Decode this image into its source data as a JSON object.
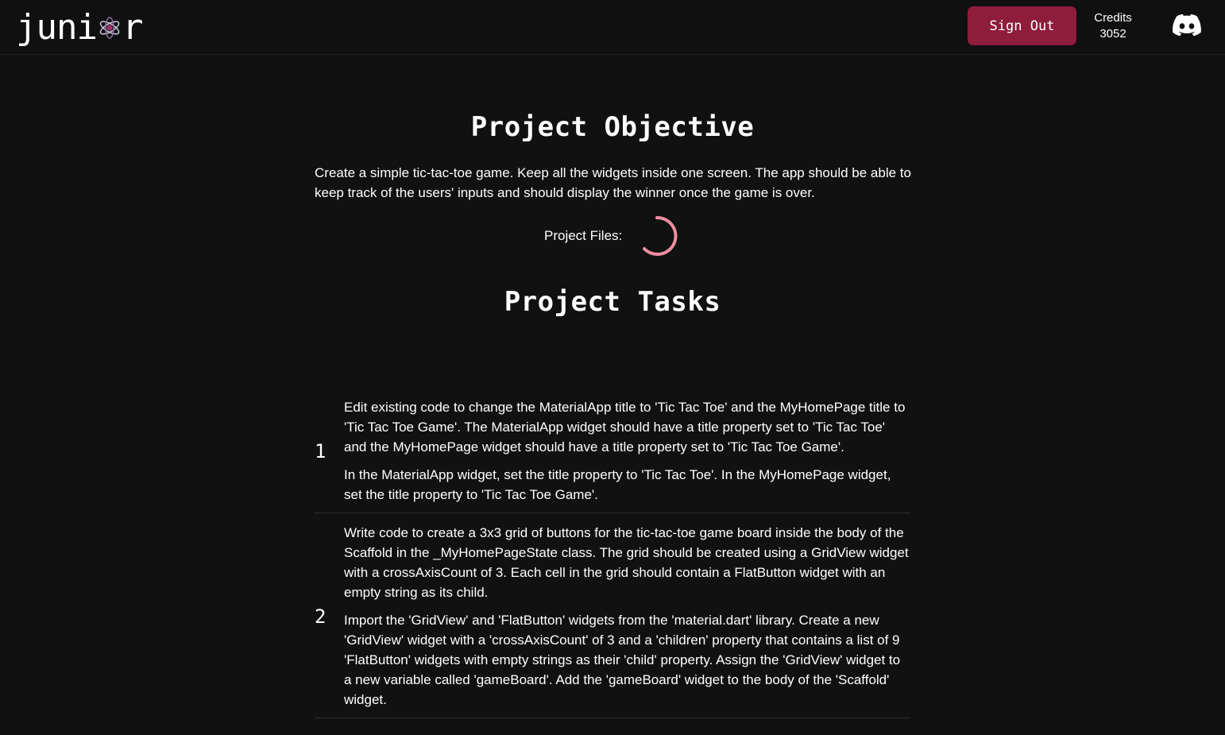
{
  "header": {
    "logo_text_left": "juni",
    "logo_text_right": "r",
    "sign_out_label": "Sign Out",
    "credits_label": "Credits",
    "credits_value": "3052",
    "discord_icon": "discord-icon"
  },
  "objective": {
    "title": "Project Objective",
    "description": "Create a simple tic-tac-toe game. Keep all the widgets inside one screen. The app should be able to keep  track of the users' inputs and should display the winner once the game is over.",
    "files_label": "Project Files:",
    "loading_indicator": "loading-spinner-icon"
  },
  "tasks": {
    "title": "Project Tasks",
    "items": [
      {
        "number": "1",
        "description": "Edit existing code to change the MaterialApp title to 'Tic Tac Toe' and the MyHomePage title to 'Tic Tac Toe Game'. The MaterialApp widget should have a title property set to 'Tic Tac Toe' and the MyHomePage widget should have a title property set to 'Tic Tac Toe Game'.",
        "hint": "In the MaterialApp widget, set the title property to 'Tic Tac Toe'. In the MyHomePage widget, set the title property to 'Tic Tac Toe Game'."
      },
      {
        "number": "2",
        "description": "Write code to create a 3x3 grid of buttons for the tic-tac-toe game board inside the body of the Scaffold in the _MyHomePageState class. The grid should be created using a GridView widget with a crossAxisCount of 3. Each cell in the grid should contain a FlatButton widget with an empty string as its child.",
        "hint": "Import the 'GridView' and 'FlatButton' widgets from the 'material.dart' library. Create a new 'GridView' widget with a 'crossAxisCount' of 3 and a 'children' property that contains a list of 9 'FlatButton' widgets with empty strings as their 'child' property. Assign the 'GridView' widget to a new variable called 'gameBoard'. Add the 'gameBoard' widget to the body of the 'Scaffold' widget."
      }
    ]
  },
  "colors": {
    "background": "#111111",
    "accent": "#8e1c3c",
    "spinner": "#f08ea0"
  }
}
